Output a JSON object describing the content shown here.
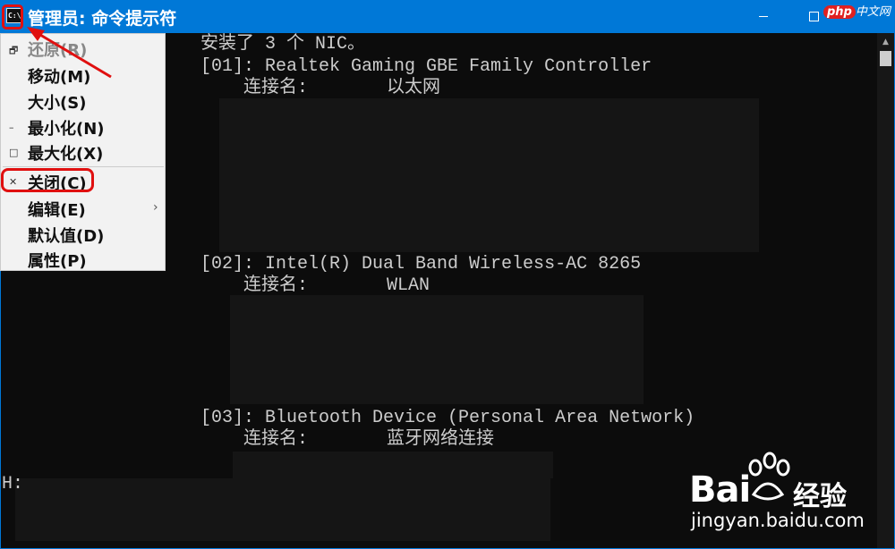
{
  "window": {
    "title": "管理员: 命令提示符",
    "icon_text": "C:\\"
  },
  "watermark_top": {
    "badge": "php",
    "text": "中文网"
  },
  "system_menu": {
    "items": [
      {
        "label": "还原(R)",
        "icon": "restore-icon",
        "glyph": "🗗",
        "disabled": true
      },
      {
        "label": "移动(M)",
        "icon": "",
        "glyph": "",
        "disabled": false
      },
      {
        "label": "大小(S)",
        "icon": "",
        "glyph": "",
        "disabled": false
      },
      {
        "label": "最小化(N)",
        "icon": "minimize-icon",
        "glyph": "–",
        "disabled": false
      },
      {
        "label": "最大化(X)",
        "icon": "maximize-icon",
        "glyph": "□",
        "disabled": false
      },
      {
        "label": "关闭(C)",
        "icon": "close-icon",
        "glyph": "✕",
        "disabled": false
      },
      {
        "label": "编辑(E)",
        "icon": "",
        "glyph": "",
        "disabled": false,
        "submenu": "›"
      },
      {
        "label": "默认值(D)",
        "icon": "",
        "glyph": "",
        "disabled": false
      },
      {
        "label": "属性(P)",
        "icon": "",
        "glyph": "",
        "disabled": false
      }
    ]
  },
  "console": {
    "line1": "安装了 3 个 NIC。",
    "nic1": "[01]: Realtek Gaming GBE Family Controller",
    "nic1_conn_label": "连接名:",
    "nic1_conn_value": "以太网",
    "nic2": "[02]: Intel(R) Dual Band Wireless-AC 8265",
    "nic2_conn_label": "连接名:",
    "nic2_conn_value": "WLAN",
    "nic3": "[03]: Bluetooth Device (Personal Area Network)",
    "nic3_conn_label": "连接名:",
    "nic3_conn_value": "蓝牙网络连接",
    "trailing": "H:"
  },
  "watermark": {
    "brand": "Bai",
    "brand_suffix": "经验",
    "url": "jingyan.baidu.com"
  },
  "colors": {
    "titlebar": "#0078d7",
    "console_bg": "#0c0c0c",
    "console_text": "#cccccc",
    "highlight": "#e01010"
  }
}
